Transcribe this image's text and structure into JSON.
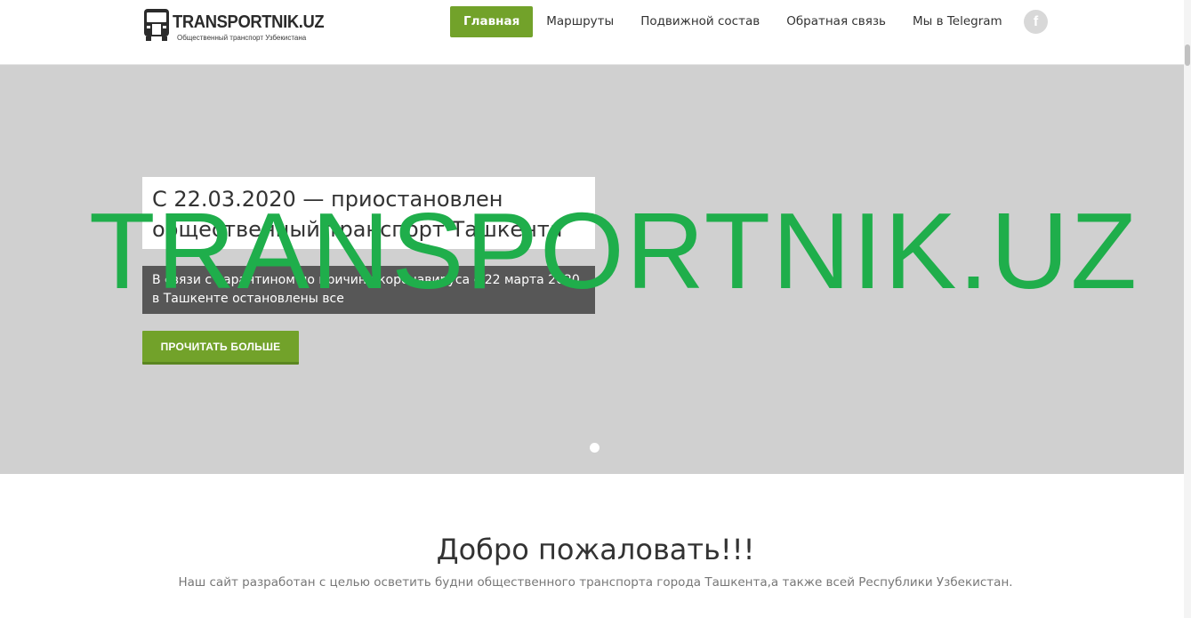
{
  "header": {
    "logo_title": "TRANSPORTNIK.UZ",
    "logo_subtitle": "Общественный транспорт Узбекистана",
    "nav": [
      {
        "label": "Главная",
        "active": true
      },
      {
        "label": "Маршруты",
        "active": false
      },
      {
        "label": "Подвижной состав",
        "active": false
      },
      {
        "label": "Обратная связь",
        "active": false
      },
      {
        "label": "Мы в Telegram",
        "active": false
      }
    ],
    "social_icon": "facebook-icon",
    "social_glyph": "f"
  },
  "hero": {
    "slide_title": "С 22.03.2020 — приостановлен общественный транспорт Ташкента",
    "slide_text": "В связи с карантином по причине коронавируса с 22 марта 2020 в Ташкенте остановлены все",
    "watermark": "TRANSPORTNIK.UZ",
    "button_label": "ПРОЧИТАТЬ БОЛЬШЕ",
    "slide_count": 1,
    "active_slide": 1
  },
  "welcome": {
    "title": "Добро пожаловать!!!",
    "text": "Наш сайт разработан с целью осветить будни общественного транспорта города Ташкента,а также всей Республики Узбекистан."
  },
  "colors": {
    "accent": "#72a22a",
    "watermark": "#1fae4b",
    "hero_bg": "#d0d0d0"
  }
}
